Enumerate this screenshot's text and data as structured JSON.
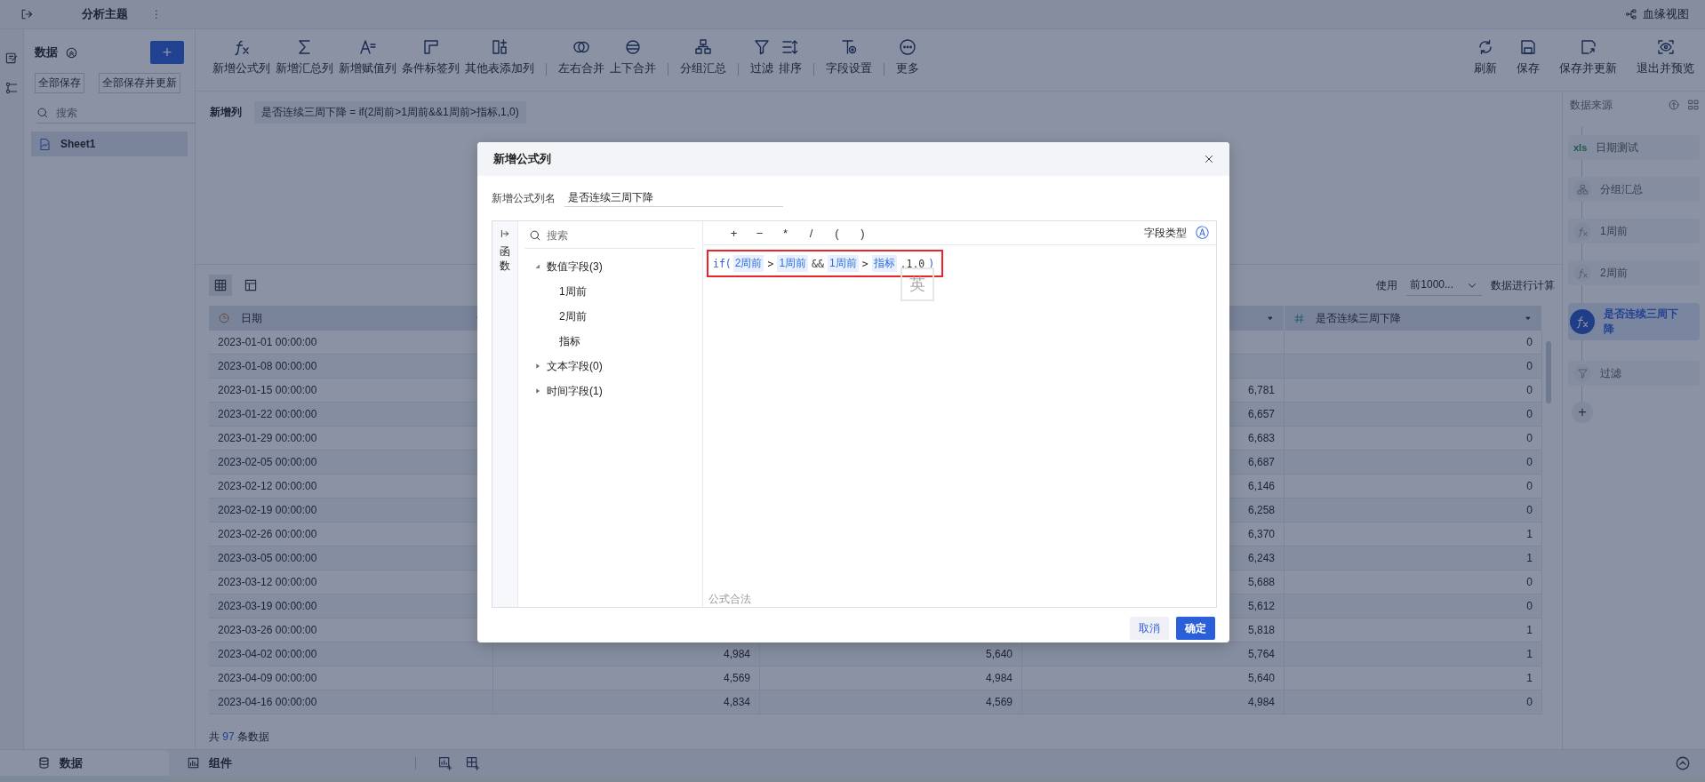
{
  "top_bar": {
    "title": "分析主题",
    "menu_glyph": "⋮",
    "lineage_link": "血缘视图"
  },
  "left_panel": {
    "title": "数据",
    "add_button": "+",
    "buttons": [
      "全部保存",
      "全部保存并更新"
    ],
    "search": {
      "placeholder": "搜索"
    },
    "tables": [
      {
        "label": "Sheet1",
        "selected": true
      }
    ]
  },
  "toolbar": {
    "groups": [
      [
        {
          "kind": "formula",
          "label": "新增公式列"
        },
        {
          "kind": "sum",
          "label": "新增汇总列"
        },
        {
          "kind": "assign",
          "label": "新增赋值列"
        },
        {
          "kind": "tag",
          "label": "条件标签列"
        },
        {
          "kind": "addcol",
          "label": "其他表添加列"
        }
      ],
      [
        {
          "kind": "lrmerge",
          "label": "左右合并"
        },
        {
          "kind": "udmerge",
          "label": "上下合并"
        }
      ],
      [
        {
          "kind": "group",
          "label": "分组汇总"
        }
      ],
      [
        {
          "kind": "filter",
          "label": "过滤"
        },
        {
          "kind": "sort",
          "label": "排序"
        }
      ],
      [
        {
          "kind": "fieldset",
          "label": "字段设置"
        }
      ],
      [
        {
          "kind": "more",
          "label": "更多"
        }
      ]
    ],
    "right_actions": [
      {
        "kind": "refresh",
        "label": "刷新"
      },
      {
        "kind": "save",
        "label": "保存"
      },
      {
        "kind": "saveupdate",
        "label": "保存并更新"
      },
      {
        "kind": "preview",
        "label": "退出并预览"
      }
    ]
  },
  "formula_bar": {
    "label": "新增列",
    "formula": "是否连续三周下降 = if(2周前>1周前&&1周前>指标,1,0)"
  },
  "view_toggle": [
    {
      "kind": "grid",
      "selected": true
    },
    {
      "kind": "layout",
      "selected": false
    }
  ],
  "sample": {
    "prefix": "使用",
    "value": "前1000...",
    "suffix": "数据进行计算"
  },
  "table": {
    "columns": [
      {
        "label": "日期",
        "kind": "time"
      },
      null,
      null,
      {
        "kind": "caret"
      },
      {
        "label": "是否连续三周下降",
        "kind": "number"
      }
    ],
    "rows": [
      {
        "cells": [
          "2023-01-01 00:00:00",
          null,
          null,
          null,
          "0"
        ]
      },
      {
        "cells": [
          "2023-01-08 00:00:00",
          null,
          null,
          null,
          "0"
        ]
      },
      {
        "cells": [
          "2023-01-15 00:00:00",
          null,
          null,
          "6,781",
          "0"
        ]
      },
      {
        "cells": [
          "2023-01-22 00:00:00",
          null,
          null,
          "6,657",
          "0"
        ]
      },
      {
        "cells": [
          "2023-01-29 00:00:00",
          null,
          null,
          "6,683",
          "0"
        ]
      },
      {
        "cells": [
          "2023-02-05 00:00:00",
          null,
          null,
          "6,687",
          "0"
        ]
      },
      {
        "cells": [
          "2023-02-12 00:00:00",
          null,
          null,
          "6,146",
          "0"
        ]
      },
      {
        "cells": [
          "2023-02-19 00:00:00",
          null,
          null,
          "6,258",
          "0"
        ]
      },
      {
        "cells": [
          "2023-02-26 00:00:00",
          null,
          null,
          "6,370",
          "1"
        ]
      },
      {
        "cells": [
          "2023-03-05 00:00:00",
          null,
          null,
          "6,243",
          "1"
        ]
      },
      {
        "cells": [
          "2023-03-12 00:00:00",
          null,
          null,
          "5,688",
          "0"
        ]
      },
      {
        "cells": [
          "2023-03-19 00:00:00",
          null,
          null,
          "5,612",
          "0"
        ]
      },
      {
        "cells": [
          "2023-03-26 00:00:00",
          null,
          null,
          "5,818",
          "1"
        ]
      },
      {
        "cells": [
          "2023-04-02 00:00:00",
          "4,984",
          "5,640",
          "5,764",
          "1"
        ]
      },
      {
        "cells": [
          "2023-04-09 00:00:00",
          "4,569",
          "4,984",
          "5,640",
          "1"
        ]
      },
      {
        "cells": [
          "2023-04-16 00:00:00",
          "4,834",
          "4,569",
          "4,984",
          "0"
        ]
      }
    ],
    "count": {
      "prefix": "共",
      "value": "97",
      "suffix": "条数据"
    }
  },
  "pipeline": {
    "title": "数据来源",
    "steps": [
      {
        "kind": "source",
        "badge": "xls",
        "label": "日期测试",
        "selected": false
      },
      {
        "kind": "group",
        "label": "分组汇总",
        "selected": false
      },
      {
        "kind": "formula",
        "label": "1周前",
        "selected": false
      },
      {
        "kind": "formula",
        "label": "2周前",
        "selected": false
      },
      {
        "kind": "formula",
        "label": "是否连续三周下降",
        "selected": true
      },
      {
        "kind": "filter",
        "label": "过滤",
        "selected": false
      }
    ],
    "add_button": "+"
  },
  "bottom_tabs": [
    {
      "kind": "data",
      "label": "数据",
      "selected": true
    },
    {
      "kind": "widget",
      "label": "组件",
      "selected": false
    }
  ],
  "dialog": {
    "title": "新增公式列",
    "name_label": "新增公式列名",
    "name_value": "是否连续三周下降",
    "side_tab": "函数",
    "search": {
      "placeholder": "搜索"
    },
    "tree": [
      {
        "label": "数值字段(3)",
        "expanded": true,
        "children": [
          {
            "label": "1周前"
          },
          {
            "label": "2周前"
          },
          {
            "label": "指标"
          }
        ]
      },
      {
        "label": "文本字段(0)",
        "expanded": false
      },
      {
        "label": "时间字段(1)",
        "expanded": false
      }
    ],
    "operators": [
      "+",
      "−",
      "*",
      "/",
      "(",
      ")"
    ],
    "field_type_label": "字段类型",
    "field_type_icon": "Ⓐ",
    "formula": [
      {
        "kind": "func",
        "text": "if("
      },
      {
        "kind": "field",
        "text": "2周前"
      },
      {
        "kind": "op",
        "text": ">"
      },
      {
        "kind": "field",
        "text": "1周前"
      },
      {
        "kind": "op",
        "text": "&&"
      },
      {
        "kind": "field",
        "text": "1周前"
      },
      {
        "kind": "op",
        "text": ">"
      },
      {
        "kind": "field",
        "text": "指标"
      },
      {
        "kind": "op",
        "text": ",1,0"
      },
      {
        "kind": "func",
        "text": ")"
      }
    ],
    "ime_indicator": "英",
    "status": "公式合法",
    "buttons": [
      {
        "kind": "secondary",
        "label": "取消"
      },
      {
        "kind": "primary",
        "label": "确定"
      }
    ]
  }
}
